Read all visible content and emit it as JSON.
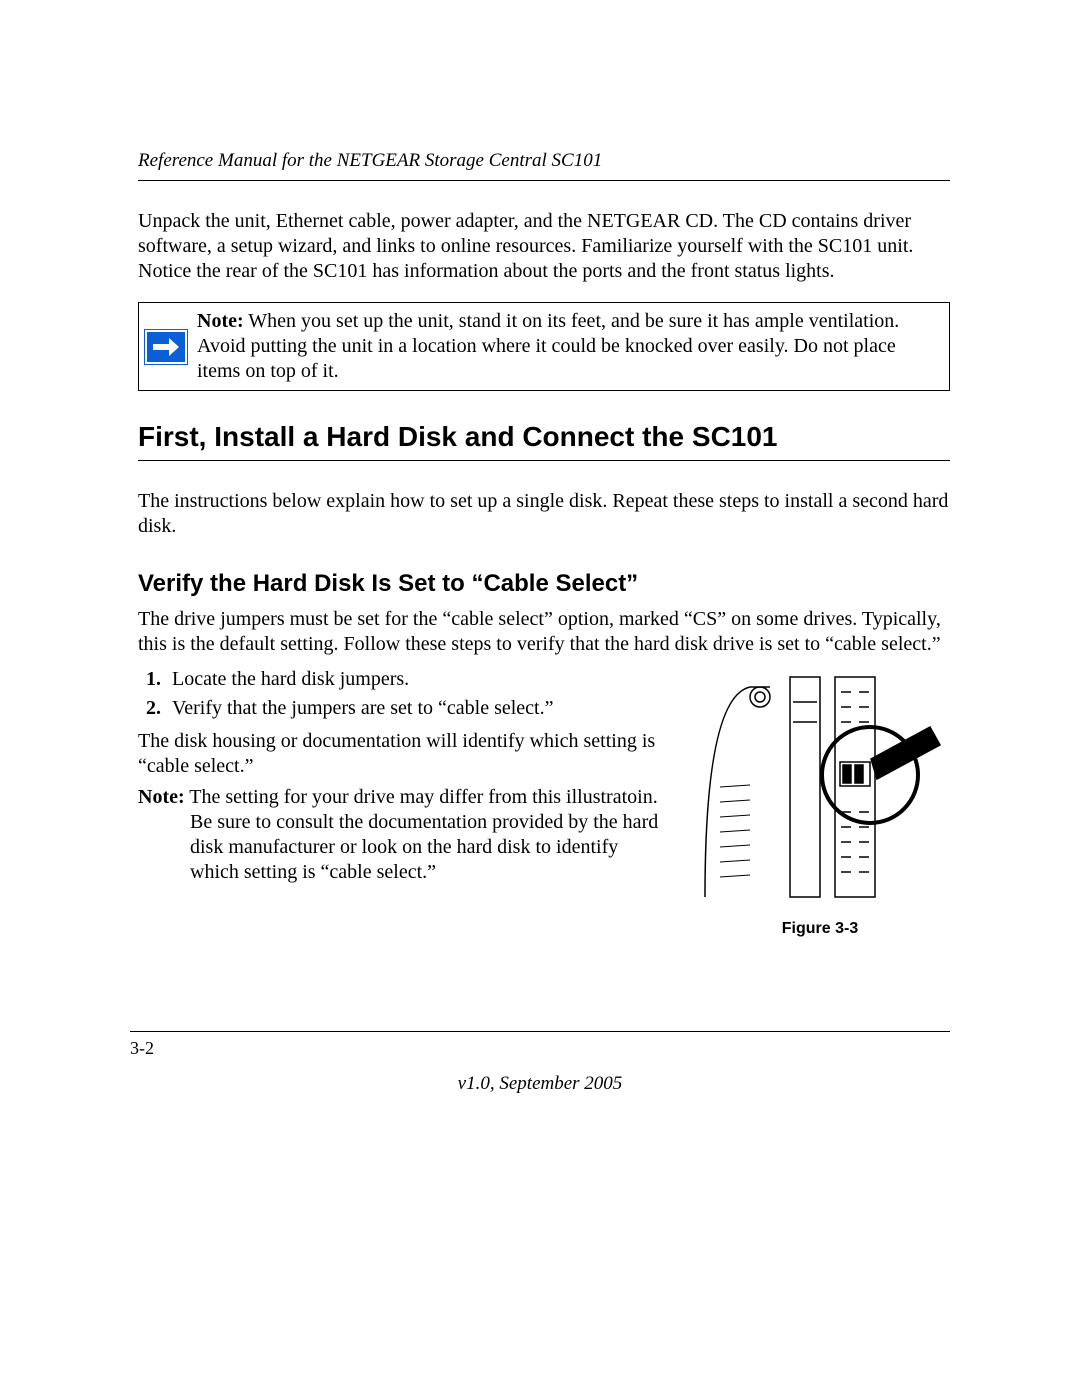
{
  "header": "Reference Manual for the NETGEAR Storage Central SC101",
  "intro": "Unpack the unit, Ethernet cable, power adapter, and the NETGEAR CD. The CD contains driver software, a setup wizard, and links to online resources. Familiarize yourself with the SC101 unit. Notice the rear of the SC101 has information about the ports and the front status lights.",
  "note": {
    "label": "Note:",
    "text": " When you set up the unit, stand it on its feet, and be sure it has ample ventilation. Avoid putting the unit in a location where it could be knocked over easily. Do not place items on top of it."
  },
  "h1": "First, Install a Hard Disk and Connect the SC101",
  "after_h1": "The instructions below explain how to set up a single disk. Repeat these steps to install a second hard disk.",
  "h2": "Verify the Hard Disk Is Set to “Cable Select”",
  "after_h2": "The drive jumpers must be set for the “cable select” option, marked “CS” on some drives. Typically, this is the default setting. Follow these steps to verify that the hard disk drive is set to “cable select.”",
  "steps": [
    "Locate the hard disk jumpers.",
    "Verify that the jumpers are set to “cable select.”"
  ],
  "after_steps": "The disk housing or documentation will identify which setting is “cable select.”",
  "note2": {
    "label": "Note:",
    "text": " The setting for your drive may differ from this illustratoin. Be sure to consult the documentation provided by the hard disk manufacturer or look on the hard disk to identify which setting is “cable select.”"
  },
  "figure_caption": "Figure 3-3",
  "page_number": "3-2",
  "version": "v1.0, September 2005"
}
